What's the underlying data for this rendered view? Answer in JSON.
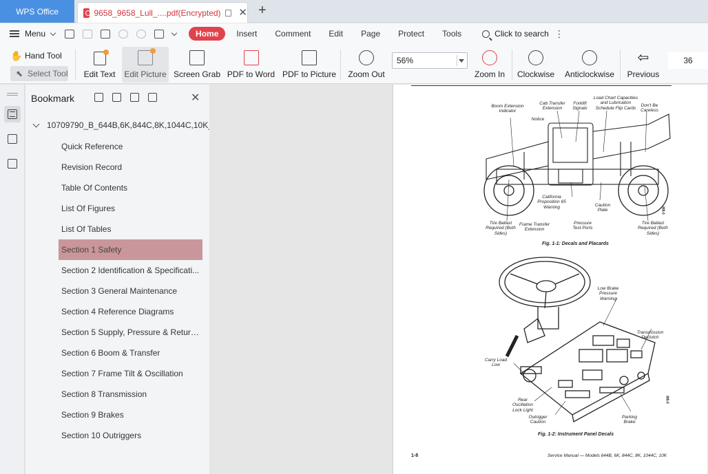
{
  "app": {
    "name": "WPS Office",
    "doc_tab_title": "9658_9658_Lull_....pdf(Encrypted)",
    "new_tab": "+"
  },
  "menubar": {
    "menu_label": "Menu",
    "items": [
      "Home",
      "Insert",
      "Comment",
      "Edit",
      "Page",
      "Protect",
      "Tools"
    ],
    "active_item": "Home",
    "search_label": "Click to search"
  },
  "toolbar": {
    "hand_tool": "Hand Tool",
    "select_tool": "Select Tool",
    "tools": [
      "Edit Text",
      "Edit Picture",
      "Screen Grab",
      "PDF to Word",
      "PDF to Picture",
      "Zoom Out",
      "Zoom In",
      "Clockwise",
      "Anticlockwise",
      "Previous"
    ],
    "zoom_value": "56%",
    "page_number": "36"
  },
  "bookmark": {
    "title": "Bookmark",
    "root": "10709790_B_644B,6K,844C,8K,1044C,10K_...",
    "items": [
      "Quick Reference",
      "Revision Record",
      "Table Of Contents",
      "List Of Figures",
      "List Of Tables",
      "Section 1 Safety",
      "Section 2 Identification & Specificati...",
      "Section 3 General Maintenance",
      "Section 4 Reference Diagrams",
      "Section 5 Supply, Pressure & Return ...",
      "Section 6 Boom & Transfer",
      "Section 7 Frame Tilt & Oscillation",
      "Section 8 Transmission",
      "Section 9 Brakes",
      "Section 10 Outriggers"
    ],
    "selected_index": 5
  },
  "document": {
    "fig1_caption": "Fig. 1-1: Decals and Placards",
    "fig2_caption": "Fig. 1-2: Instrument Panel Decals",
    "fig1_callouts": {
      "boom_ext": "Boom Extension Indicator",
      "cab_transfer": "Cab Transfer Extension",
      "forklift": "Forklift Signals",
      "load_chart": "Load Chart Capacities and Lubrication Schedule Flip Cards",
      "dont_be": "Don't Be Careless",
      "notice": "Notice",
      "california": "California Proposition 65 Warning",
      "caution_plate": "Caution Plate",
      "tire_left": "Tire Ballast Required (Both Sides)",
      "frame_transfer": "Frame Transfer Extension",
      "pressure": "Pressure Test Ports",
      "tire_right": "Tire Ballast Required (Both Sides)"
    },
    "fig2_callouts": {
      "low_brake": "Low Brake Pressure Warning",
      "trans_declutch": "Transmission Declutch",
      "carry_load": "Carry Load Low",
      "rear_osc": "Rear Oscillation Lock Light",
      "outrigger": "Outrigger Caution",
      "parking": "Parking Brake"
    },
    "footer_page": "1-8",
    "footer_title": "Service Manual — Models 644B, 6K, 844C, 8K, 1044C, 10K",
    "fig1_code": "M8-0",
    "fig2_code": "M8-0"
  },
  "colors": {
    "accent": "#e0434b",
    "app_tab": "#4a90e2",
    "selected_bookmark": "#c9969c"
  }
}
